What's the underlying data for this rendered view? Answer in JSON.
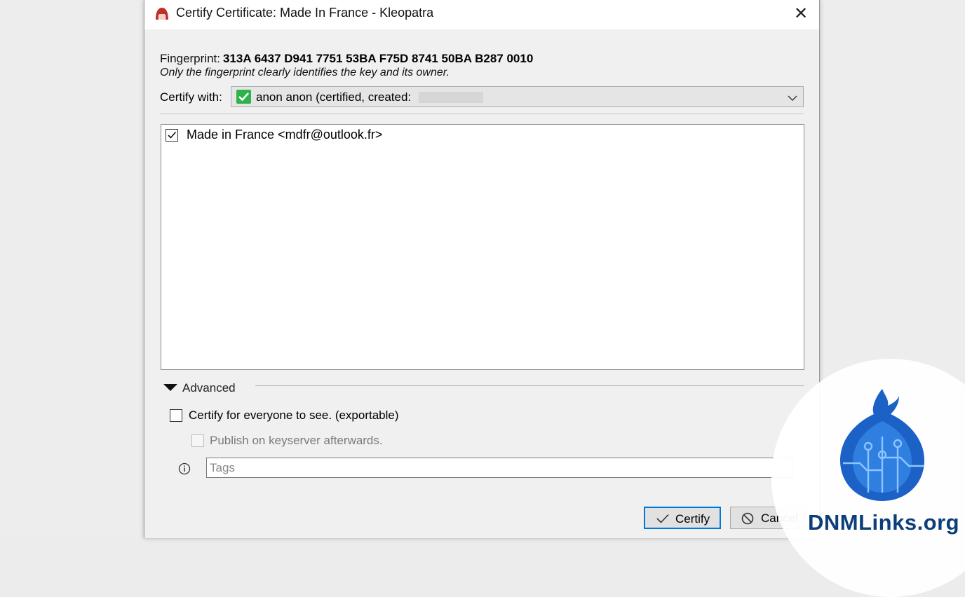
{
  "window": {
    "title": "Certify Certificate: Made In France - Kleopatra",
    "close_glyph": "✕"
  },
  "fingerprint": {
    "label": "Fingerprint:",
    "value": "313A 6437 D941 7751 53BA F75D 8741 50BA B287 0010",
    "note": "Only the fingerprint clearly identifies the key and its owner."
  },
  "certify_with": {
    "label": "Certify with:",
    "selected": "anon anon (certified,  created:"
  },
  "user_ids": [
    {
      "label": "Made in France <mdfr@outlook.fr>",
      "checked": true
    }
  ],
  "advanced": {
    "label": "Advanced",
    "expanded": true,
    "exportable_label": "Certify for everyone to see. (exportable)",
    "exportable_checked": false,
    "publish_label": "Publish on keyserver afterwards.",
    "publish_checked": false,
    "publish_enabled": false,
    "tags_placeholder": "Tags",
    "tags_value": ""
  },
  "buttons": {
    "certify": "Certify",
    "cancel": "Cancel"
  },
  "watermark": {
    "text": "DNMLinks.org"
  },
  "colors": {
    "accent": "#0078d7",
    "check_green": "#2cb34a",
    "watermark_blue": "#0c3e7a"
  }
}
